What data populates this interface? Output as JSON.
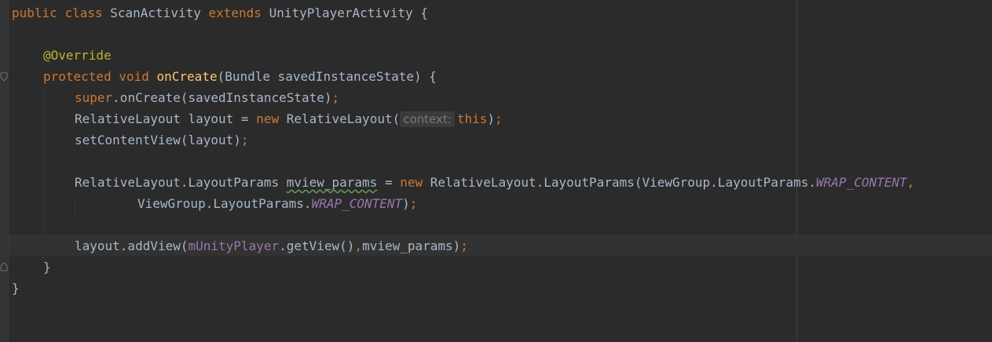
{
  "editor": {
    "language": "java",
    "colors": {
      "background": "#2b2b2b",
      "keyword": "#cc7832",
      "annotation": "#bbb529",
      "method_declaration": "#ffc66d",
      "field": "#9876aa",
      "identifier": "#a9b7c6",
      "hint": "#787878"
    },
    "lines": {
      "l1": {
        "kw_public": "public",
        "kw_class": "class",
        "name": "ScanActivity",
        "kw_extends": "extends",
        "parent": "UnityPlayerActivity",
        "brace": "{"
      },
      "l3": {
        "annotation": "@Override"
      },
      "l4": {
        "kw_protected": "protected",
        "kw_void": "void",
        "method": "onCreate",
        "params": "(Bundle savedInstanceState) {"
      },
      "l5": {
        "kw_super": "super",
        "call": ".onCreate(savedInstanceState)",
        "semi": ";"
      },
      "l6": {
        "decl": "RelativeLayout layout = ",
        "kw_new": "new",
        "ctor": " RelativeLayout(",
        "hint": "context:",
        "kw_this": "this",
        "close": ")",
        "semi": ";"
      },
      "l7": {
        "call": "setContentView(layout)",
        "semi": ";"
      },
      "l9": {
        "type": "RelativeLayout.LayoutParams ",
        "var": "mview_params",
        "assign": " = ",
        "kw_new": "new",
        "ctor": " RelativeLayout.LayoutParams(ViewGroup.LayoutParams.",
        "const": "WRAP_CONTENT",
        "comma": ","
      },
      "l10": {
        "prefix": "ViewGroup.LayoutParams.",
        "const": "WRAP_CONTENT",
        "close": ")",
        "semi": ";"
      },
      "l12": {
        "call": "layout.addView(",
        "field": "mUnityPlayer",
        "call2": ".getView()",
        "comma": ",",
        "args": "mview_params)",
        "semi": ";"
      },
      "l13": {
        "brace": "}"
      },
      "l14": {
        "brace": "}"
      }
    }
  }
}
